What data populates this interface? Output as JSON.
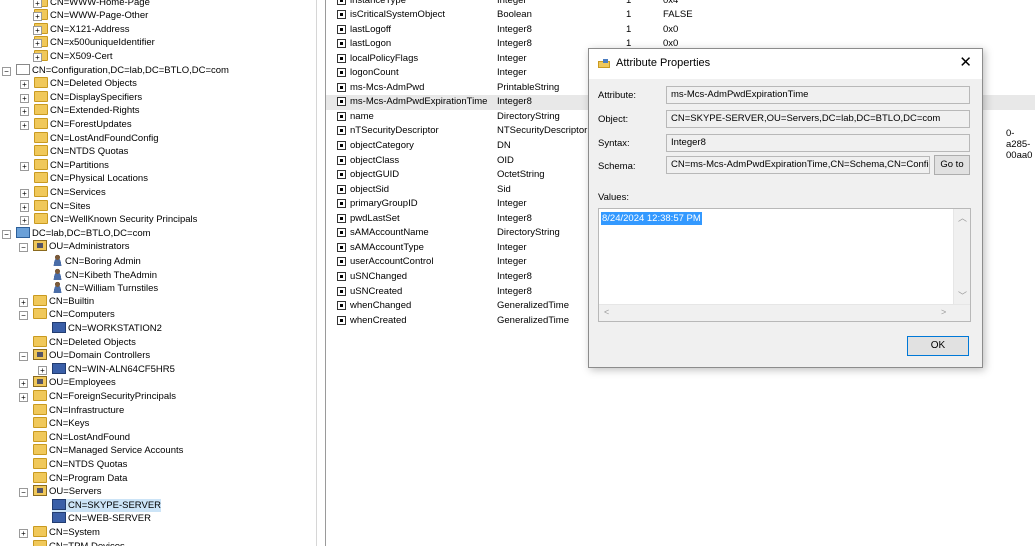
{
  "tree": {
    "items": [
      {
        "label": "CN=WWW-Home-Page",
        "icon": "folder"
      },
      {
        "label": "CN=WWW-Page-Other",
        "icon": "folder"
      },
      {
        "label": "CN=X121-Address",
        "icon": "folder"
      },
      {
        "label": "CN=x500uniqueIdentifier",
        "icon": "folder"
      },
      {
        "label": "CN=X509-Cert",
        "icon": "folder"
      },
      {
        "label": "CN=Configuration,DC=lab,DC=BTLO,DC=com",
        "icon": "config"
      },
      {
        "label": "CN=Deleted Objects",
        "icon": "folder"
      },
      {
        "label": "CN=DisplaySpecifiers",
        "icon": "folder"
      },
      {
        "label": "CN=Extended-Rights",
        "icon": "folder"
      },
      {
        "label": "CN=ForestUpdates",
        "icon": "folder"
      },
      {
        "label": "CN=LostAndFoundConfig",
        "icon": "folder"
      },
      {
        "label": "CN=NTDS Quotas",
        "icon": "folder"
      },
      {
        "label": "CN=Partitions",
        "icon": "folder"
      },
      {
        "label": "CN=Physical Locations",
        "icon": "folder"
      },
      {
        "label": "CN=Services",
        "icon": "folder"
      },
      {
        "label": "CN=Sites",
        "icon": "folder"
      },
      {
        "label": "CN=WellKnown Security Principals",
        "icon": "folder"
      },
      {
        "label": "DC=lab,DC=BTLO,DC=com",
        "icon": "domain"
      },
      {
        "label": "OU=Administrators",
        "icon": "ou"
      },
      {
        "label": "CN=Boring Admin",
        "icon": "user"
      },
      {
        "label": "CN=Kibeth TheAdmin",
        "icon": "user"
      },
      {
        "label": "CN=William Turnstiles",
        "icon": "user"
      },
      {
        "label": "CN=Builtin",
        "icon": "folder"
      },
      {
        "label": "CN=Computers",
        "icon": "folder"
      },
      {
        "label": "CN=WORKSTATION2",
        "icon": "computer"
      },
      {
        "label": "CN=Deleted Objects",
        "icon": "folder"
      },
      {
        "label": "OU=Domain Controllers",
        "icon": "ou"
      },
      {
        "label": "CN=WIN-ALN64CF5HR5",
        "icon": "computer"
      },
      {
        "label": "OU=Employees",
        "icon": "ou"
      },
      {
        "label": "CN=ForeignSecurityPrincipals",
        "icon": "folder"
      },
      {
        "label": "CN=Infrastructure",
        "icon": "folder"
      },
      {
        "label": "CN=Keys",
        "icon": "folder"
      },
      {
        "label": "CN=LostAndFound",
        "icon": "folder"
      },
      {
        "label": "CN=Managed Service Accounts",
        "icon": "folder"
      },
      {
        "label": "CN=NTDS Quotas",
        "icon": "folder"
      },
      {
        "label": "CN=Program Data",
        "icon": "folder"
      },
      {
        "label": "OU=Servers",
        "icon": "ou"
      },
      {
        "label": "CN=SKYPE-SERVER",
        "icon": "computer",
        "selected": true
      },
      {
        "label": "CN=WEB-SERVER",
        "icon": "computer"
      },
      {
        "label": "CN=System",
        "icon": "folder"
      },
      {
        "label": "CN=TPM Devices",
        "icon": "folder"
      }
    ]
  },
  "attributes": {
    "rows": [
      {
        "name": "instanceType",
        "syntax": "Integer",
        "count": "1",
        "value": "0x4"
      },
      {
        "name": "isCriticalSystemObject",
        "syntax": "Boolean",
        "count": "1",
        "value": "FALSE"
      },
      {
        "name": "lastLogoff",
        "syntax": "Integer8",
        "count": "1",
        "value": "0x0"
      },
      {
        "name": "lastLogon",
        "syntax": "Integer8",
        "count": "1",
        "value": "0x0"
      },
      {
        "name": "localPolicyFlags",
        "syntax": "Integer",
        "count": "",
        "value": ""
      },
      {
        "name": "logonCount",
        "syntax": "Integer",
        "count": "",
        "value": ""
      },
      {
        "name": "ms-Mcs-AdmPwd",
        "syntax": "PrintableString",
        "count": "",
        "value": ""
      },
      {
        "name": "ms-Mcs-AdmPwdExpirationTime",
        "syntax": "Integer8",
        "count": "",
        "value": "",
        "highlighted": true
      },
      {
        "name": "name",
        "syntax": "DirectoryString",
        "count": "",
        "value": ""
      },
      {
        "name": "nTSecurityDescriptor",
        "syntax": "NTSecurityDescriptor",
        "count": "",
        "value": ""
      },
      {
        "name": "objectCategory",
        "syntax": "DN",
        "count": "",
        "value": ""
      },
      {
        "name": "objectClass",
        "syntax": "OID",
        "count": "",
        "value": ""
      },
      {
        "name": "objectGUID",
        "syntax": "OctetString",
        "count": "",
        "value": ""
      },
      {
        "name": "objectSid",
        "syntax": "Sid",
        "count": "",
        "value": ""
      },
      {
        "name": "primaryGroupID",
        "syntax": "Integer",
        "count": "",
        "value": ""
      },
      {
        "name": "pwdLastSet",
        "syntax": "Integer8",
        "count": "",
        "value": ""
      },
      {
        "name": "sAMAccountName",
        "syntax": "DirectoryString",
        "count": "",
        "value": ""
      },
      {
        "name": "sAMAccountType",
        "syntax": "Integer",
        "count": "",
        "value": ""
      },
      {
        "name": "userAccountControl",
        "syntax": "Integer",
        "count": "",
        "value": ""
      },
      {
        "name": "uSNChanged",
        "syntax": "Integer8",
        "count": "",
        "value": ""
      },
      {
        "name": "uSNCreated",
        "syntax": "Integer8",
        "count": "",
        "value": ""
      },
      {
        "name": "whenChanged",
        "syntax": "GeneralizedTime",
        "count": "",
        "value": ""
      },
      {
        "name": "whenCreated",
        "syntax": "GeneralizedTime",
        "count": "",
        "value": ""
      }
    ],
    "overflow_text": "0-a285-00aa0"
  },
  "dialog": {
    "title": "Attribute Properties",
    "close": "✕",
    "attribute_label": "Attribute:",
    "attribute_value": "ms-Mcs-AdmPwdExpirationTime",
    "object_label": "Object:",
    "object_value": "CN=SKYPE-SERVER,OU=Servers,DC=lab,DC=BTLO,DC=com",
    "syntax_label": "Syntax:",
    "syntax_value": "Integer8",
    "schema_label": "Schema:",
    "schema_value": "CN=ms-Mcs-AdmPwdExpirationTime,CN=Schema,CN=Configura",
    "goto_label": "Go to",
    "values_label": "Values:",
    "values": [
      "8/24/2024 12:38:57 PM"
    ],
    "ok_label": "OK"
  }
}
